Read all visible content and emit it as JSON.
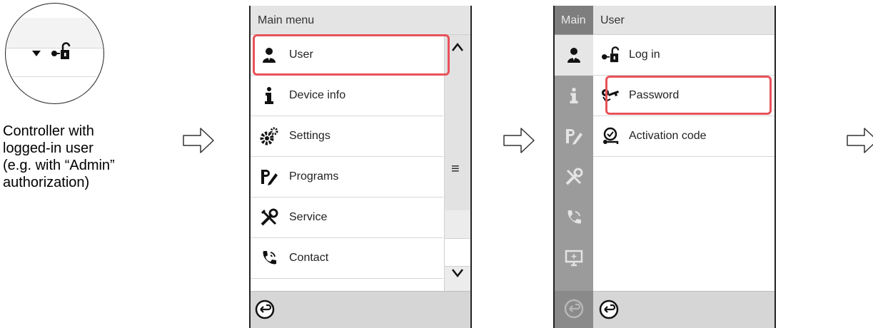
{
  "caption": {
    "line1": "Controller with",
    "line2": "logged-in user",
    "line3": "(e.g. with “Admin”",
    "line4": "authorization)"
  },
  "main_menu": {
    "title": "Main menu",
    "items": [
      {
        "label": "User",
        "icon": "user-icon"
      },
      {
        "label": "Device info",
        "icon": "info-icon"
      },
      {
        "label": "Settings",
        "icon": "gears-icon"
      },
      {
        "label": "Programs",
        "icon": "programs-icon"
      },
      {
        "label": "Service",
        "icon": "tools-icon"
      },
      {
        "label": "Contact",
        "icon": "phone-icon"
      }
    ],
    "highlighted": "User"
  },
  "user_menu": {
    "sidebar_title": "Main",
    "title": "User",
    "items": [
      {
        "label": "Log in",
        "icon": "login-lock-icon"
      },
      {
        "label": "Password",
        "icon": "key-icon"
      },
      {
        "label": "Activation code",
        "icon": "activation-icon"
      }
    ],
    "highlighted": "Password"
  },
  "colors": {
    "highlight": "#e8525a",
    "title_bg": "#e4e4e4",
    "footer_bg": "#d6d6d6",
    "sidebar_bg": "#9b9b9b"
  }
}
